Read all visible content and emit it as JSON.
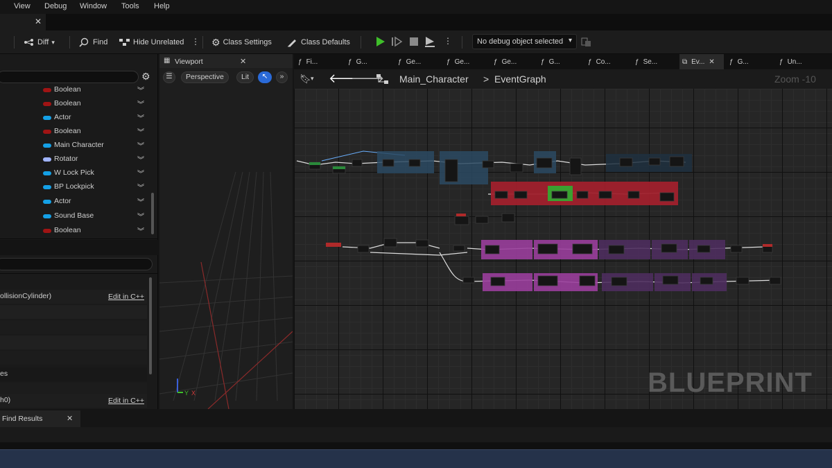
{
  "menu": [
    "View",
    "Debug",
    "Window",
    "Tools",
    "Help"
  ],
  "toolbar": {
    "diff": "Diff",
    "find": "Find",
    "hide_unrelated": "Hide Unrelated",
    "class_settings": "Class Settings",
    "class_defaults": "Class Defaults",
    "debug_object": "No debug object selected"
  },
  "variables": [
    {
      "type": "Boolean",
      "color": "#a01414"
    },
    {
      "type": "Boolean",
      "color": "#a01414"
    },
    {
      "type": "Actor",
      "color": "#14a0e6"
    },
    {
      "type": "Boolean",
      "color": "#a01414"
    },
    {
      "type": "Main Character",
      "color": "#14a0e6"
    },
    {
      "type": "Rotator",
      "color": "#a0b4ff"
    },
    {
      "type": "W Lock Pick",
      "color": "#14a0e6"
    },
    {
      "type": "BP Lockpick",
      "color": "#14a0e6"
    },
    {
      "type": "Actor",
      "color": "#14a0e6"
    },
    {
      "type": "Sound Base",
      "color": "#14a0e6"
    },
    {
      "type": "Boolean",
      "color": "#a01414"
    }
  ],
  "details": {
    "component_label": "ollisionCylinder)",
    "edit_cpp": "Edit in C++",
    "section_label": "es",
    "component2_label": "h0)",
    "edit_cpp2": "Edit in C++"
  },
  "viewport": {
    "tab_label": "Viewport",
    "perspective": "Perspective",
    "lit": "Lit"
  },
  "graph_tabs": [
    "Fi...",
    "G...",
    "Ge...",
    "Ge...",
    "Ge...",
    "G...",
    "Co...",
    "Se...",
    "Ev...",
    "G...",
    "Un..."
  ],
  "graph": {
    "breadcrumb_root": "Main_Character",
    "breadcrumb_sep": ">",
    "breadcrumb_leaf": "EventGraph",
    "zoom": "Zoom -10",
    "watermark": "BLUEPRINT"
  },
  "bottom": {
    "find_results": "Find Results"
  }
}
